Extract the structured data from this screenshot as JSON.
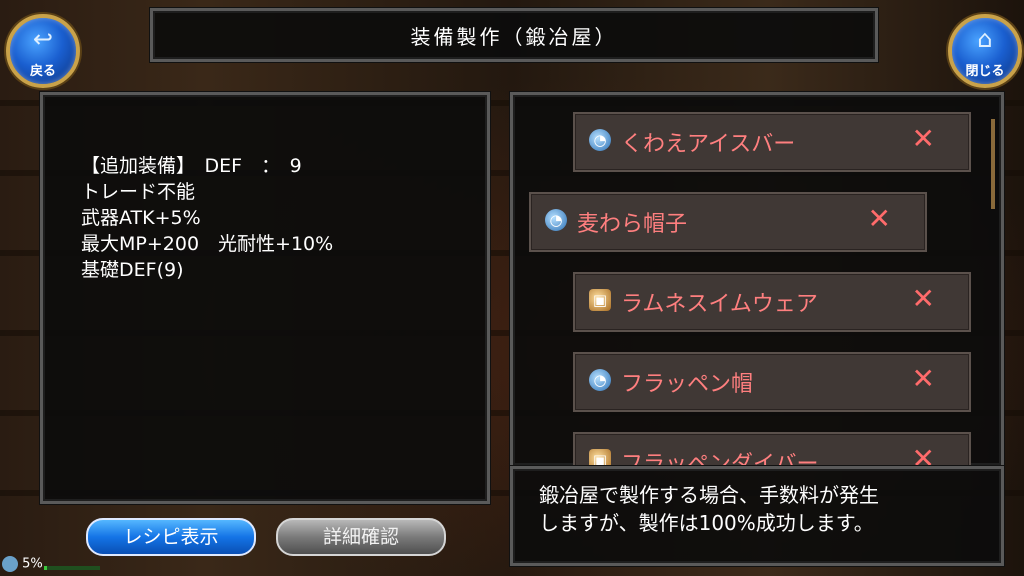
{
  "header": {
    "title": "装備製作（鍛冶屋）"
  },
  "back_button": {
    "label": "戻る",
    "icon": "back-arrow-icon"
  },
  "close_button": {
    "label": "閉じる",
    "icon": "home-icon"
  },
  "info": {
    "lines": [
      "【追加装備】　DEF　：　9",
      "トレード不能",
      "武器ATK+5%",
      "最大MP+200　光耐性+10%",
      "基礎DEF(9)"
    ]
  },
  "buttons": {
    "recipe": "レシピ表示",
    "detail": "詳細確認"
  },
  "items": [
    {
      "name": "くわえアイスバー",
      "icon": "hat-icon"
    },
    {
      "name": "麦わら帽子",
      "icon": "hat-icon"
    },
    {
      "name": "ラムネスイムウェア",
      "icon": "swimsuit-icon"
    },
    {
      "name": "フラッペン帽",
      "icon": "hat-icon"
    },
    {
      "name": "フラッペンダイバー",
      "icon": "swimsuit-icon"
    }
  ],
  "remove_symbol": "✕",
  "message": {
    "line1": "鍛冶屋で製作する場合、手数料が発生",
    "line2": "しますが、製作は100%成功します。"
  },
  "status": {
    "percent_text": "5%",
    "progress": 0.05
  },
  "colors": {
    "item_text": "#ff7f7f",
    "button_blue": "#1474e6",
    "button_gray": "#7a7a7a"
  }
}
